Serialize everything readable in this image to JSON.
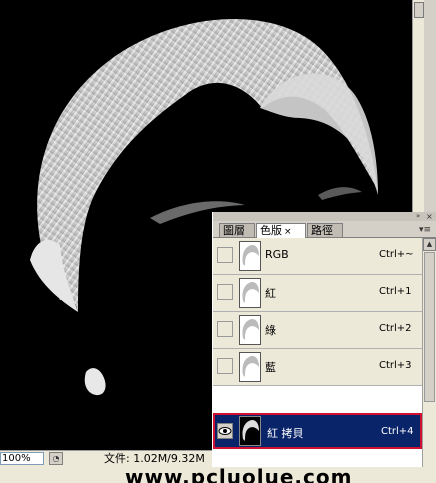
{
  "document": {
    "zoom": "100%",
    "doc_info": "文件: 1.02M/9.32M"
  },
  "watermark": "www.pcluolue.com",
  "channels_panel": {
    "tabs": [
      {
        "label": "圖層",
        "active": false
      },
      {
        "label": "色版",
        "active": true,
        "close": "×"
      },
      {
        "label": "路徑",
        "active": false
      }
    ],
    "collapse_icon": "»",
    "close_icon": "×",
    "menu_icon": "▾≡",
    "channels": [
      {
        "name": "RGB",
        "shortcut": "Ctrl+~",
        "visible": false,
        "selected": false
      },
      {
        "name": "紅",
        "shortcut": "Ctrl+1",
        "visible": false,
        "selected": false
      },
      {
        "name": "綠",
        "shortcut": "Ctrl+2",
        "visible": false,
        "selected": false
      },
      {
        "name": "藍",
        "shortcut": "Ctrl+3",
        "visible": false,
        "selected": false
      },
      {
        "name": "紅 拷貝",
        "shortcut": "Ctrl+4",
        "visible": true,
        "selected": true
      }
    ]
  },
  "colors": {
    "selection_bg": "#0a246a",
    "selection_border": "#d01030",
    "canvas_bg": "#000000"
  }
}
